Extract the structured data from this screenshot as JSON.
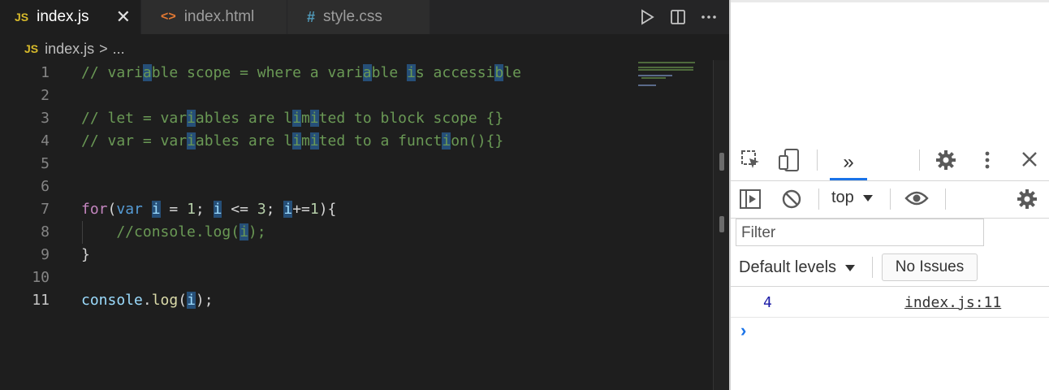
{
  "editor": {
    "tabs": [
      {
        "icon": "JS",
        "label": "index.js",
        "active": true,
        "close": "✕"
      },
      {
        "icon": "<>",
        "label": "index.html",
        "active": false
      },
      {
        "icon": "#",
        "label": "style.css",
        "active": false
      }
    ],
    "breadcrumb": {
      "icon": "JS",
      "file": "index.js",
      "separator": ">",
      "more": "..."
    },
    "lines": [
      {
        "n": "1",
        "text": "// variable scope = where a variable is accessible"
      },
      {
        "n": "2",
        "text": ""
      },
      {
        "n": "3",
        "text": "// let = variables are limited to block scope {}"
      },
      {
        "n": "4",
        "text": "// var = variables are limited to a function(){}"
      },
      {
        "n": "5",
        "text": ""
      },
      {
        "n": "6",
        "text": ""
      },
      {
        "n": "7",
        "text": "for(var i = 1; i <= 3; i+=1){"
      },
      {
        "n": "8",
        "text": "    //console.log(i);"
      },
      {
        "n": "9",
        "text": "}"
      },
      {
        "n": "10",
        "text": ""
      },
      {
        "n": "11",
        "text": "console.log(i);"
      }
    ],
    "current_line": "11"
  },
  "devtools": {
    "more_tabs": "»",
    "context": "top",
    "filter_placeholder": "Filter",
    "levels": "Default levels",
    "issues": "No Issues",
    "console": {
      "value": "4",
      "source": "index.js:11"
    },
    "prompt": "›"
  },
  "colors": {
    "comment": "#6a9955",
    "keyword": "#569cd6",
    "control": "#c586c0",
    "variable": "#9cdcfe",
    "number": "#b5cea8",
    "highlight": "#264f78",
    "js_icon": "#d7ba2b",
    "html_icon": "#e37933",
    "css_icon": "#519aba"
  }
}
